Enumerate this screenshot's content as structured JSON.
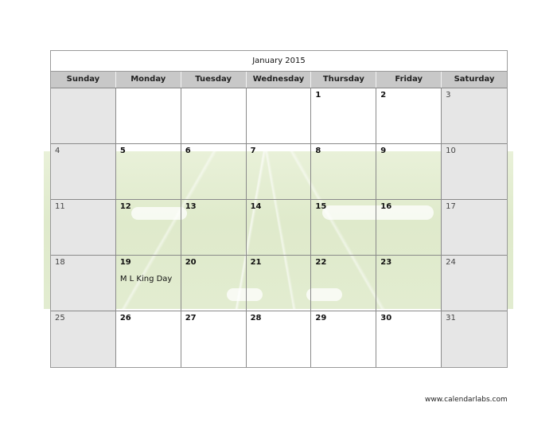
{
  "calendar": {
    "title": "January 2015",
    "weekdays": [
      "Sunday",
      "Monday",
      "Tuesday",
      "Wednesday",
      "Thursday",
      "Friday",
      "Saturday"
    ],
    "weeks": [
      [
        {
          "day": ""
        },
        {
          "day": ""
        },
        {
          "day": ""
        },
        {
          "day": ""
        },
        {
          "day": "1"
        },
        {
          "day": "2"
        },
        {
          "day": "3"
        }
      ],
      [
        {
          "day": "4"
        },
        {
          "day": "5"
        },
        {
          "day": "6"
        },
        {
          "day": "7"
        },
        {
          "day": "8"
        },
        {
          "day": "9"
        },
        {
          "day": "10"
        }
      ],
      [
        {
          "day": "11"
        },
        {
          "day": "12"
        },
        {
          "day": "13"
        },
        {
          "day": "14"
        },
        {
          "day": "15"
        },
        {
          "day": "16"
        },
        {
          "day": "17"
        }
      ],
      [
        {
          "day": "18"
        },
        {
          "day": "19",
          "event": "M L King Day"
        },
        {
          "day": "20"
        },
        {
          "day": "21"
        },
        {
          "day": "22"
        },
        {
          "day": "23"
        },
        {
          "day": "24"
        }
      ],
      [
        {
          "day": "25"
        },
        {
          "day": "26"
        },
        {
          "day": "27"
        },
        {
          "day": "28"
        },
        {
          "day": "29"
        },
        {
          "day": "30"
        },
        {
          "day": "31"
        }
      ]
    ]
  },
  "footer": {
    "url": "www.calendarlabs.com"
  },
  "colors": {
    "weekend_bg": "#e6e6e6",
    "header_bg": "#c8c8c8",
    "field_green": "#e2ecd0"
  }
}
